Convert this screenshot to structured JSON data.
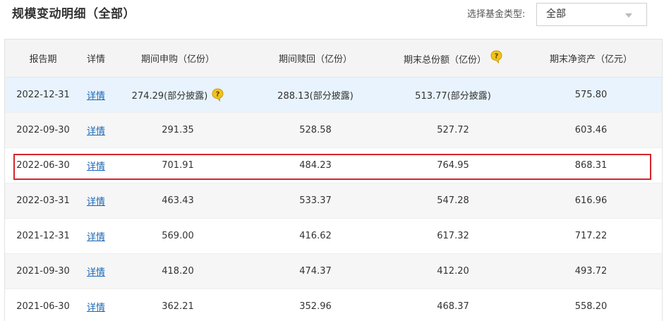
{
  "header": {
    "title": "规模变动明细（全部）",
    "filter_label": "选择基金类型:",
    "filter_value": "全部"
  },
  "table": {
    "columns": [
      "报告期",
      "详情",
      "期间申购（亿份）",
      "期间赎回（亿份）",
      "期末总份额（亿份）",
      "期末净资产（亿元）"
    ],
    "rows": [
      {
        "date": "2022-12-31",
        "detail": "详情",
        "purchase": "274.29(部分披露)",
        "redemption": "288.13(部分披露)",
        "total_shares": "513.77(部分披露)",
        "net_assets": "575.80"
      },
      {
        "date": "2022-09-30",
        "detail": "详情",
        "purchase": "291.35",
        "redemption": "528.58",
        "total_shares": "527.72",
        "net_assets": "603.46"
      },
      {
        "date": "2022-06-30",
        "detail": "详情",
        "purchase": "701.91",
        "redemption": "484.23",
        "total_shares": "764.95",
        "net_assets": "868.31"
      },
      {
        "date": "2022-03-31",
        "detail": "详情",
        "purchase": "463.43",
        "redemption": "533.37",
        "total_shares": "547.28",
        "net_assets": "616.96"
      },
      {
        "date": "2021-12-31",
        "detail": "详情",
        "purchase": "569.00",
        "redemption": "416.62",
        "total_shares": "617.32",
        "net_assets": "717.22"
      },
      {
        "date": "2021-09-30",
        "detail": "详情",
        "purchase": "418.20",
        "redemption": "474.37",
        "total_shares": "412.20",
        "net_assets": "493.72"
      },
      {
        "date": "2021-06-30",
        "detail": "详情",
        "purchase": "362.21",
        "redemption": "352.96",
        "total_shares": "468.37",
        "net_assets": "558.20"
      }
    ]
  },
  "icons": {
    "help": "question-bubble-icon"
  },
  "colors": {
    "link": "#1a67b5",
    "highlight_row": "#e8f3fd",
    "highlight_border": "#d5262c",
    "help_icon": "#f2c21b"
  }
}
